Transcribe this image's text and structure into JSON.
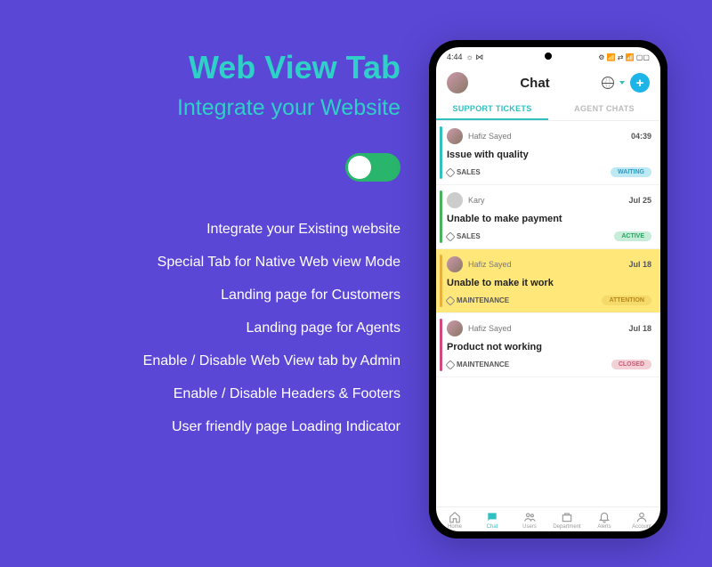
{
  "left": {
    "title": "Web View Tab",
    "subtitle": "Integrate your Website",
    "features": [
      "Integrate your Existing website",
      "Special Tab for Native Web view Mode",
      "Landing page for Customers",
      "Landing page for Agents",
      "Enable / Disable Web View tab by Admin",
      "Enable / Disable Headers & Footers",
      "User friendly page Loading Indicator"
    ]
  },
  "phone": {
    "statusbar": {
      "time": "4:44",
      "carrier": "☼ ⋈",
      "icons": "⚙ 📶 ⇄ 📶 ▢▢"
    },
    "header": {
      "title": "Chat",
      "add_symbol": "+"
    },
    "tabs": {
      "support": "SUPPORT TICKETS",
      "agent": "AGENT CHATS"
    },
    "tickets": [
      {
        "name": "Hafiz Sayed",
        "time": "04:39",
        "subject": "Issue with quality",
        "tag": "SALES",
        "status": "WAITING",
        "status_class": "st-waiting",
        "bar_color": "#2fc0bf",
        "avatar": "photo"
      },
      {
        "name": "Kary",
        "time": "Jul 25",
        "subject": "Unable to make payment",
        "tag": "SALES",
        "status": "ACTIVE",
        "status_class": "st-active",
        "bar_color": "#46b55a",
        "avatar": "plain"
      },
      {
        "name": "Hafiz Sayed",
        "time": "Jul 18",
        "subject": "Unable to make it work",
        "tag": "MAINTENANCE",
        "status": "ATTENTION",
        "status_class": "st-attention",
        "bar_color": "#e8b23a",
        "avatar": "photo",
        "highlight": true
      },
      {
        "name": "Hafiz Sayed",
        "time": "Jul 18",
        "subject": "Product not working",
        "tag": "MAINTENANCE",
        "status": "CLOSED",
        "status_class": "st-closed",
        "bar_color": "#d24a79",
        "avatar": "photo"
      }
    ],
    "nav": [
      {
        "label": "Home",
        "icon": "home"
      },
      {
        "label": "Chat",
        "icon": "chat",
        "active": true
      },
      {
        "label": "Users",
        "icon": "users"
      },
      {
        "label": "Department",
        "icon": "dept"
      },
      {
        "label": "Alerts",
        "icon": "bell"
      },
      {
        "label": "Account",
        "icon": "account"
      }
    ]
  }
}
